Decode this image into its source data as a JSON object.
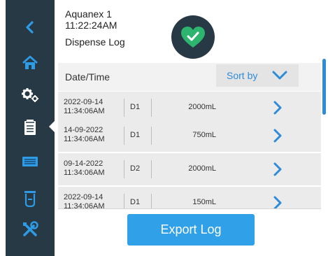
{
  "header": {
    "device_name": "Aquanex 1",
    "time": "11:22:24AM",
    "page_title": "Dispense Log",
    "status_icon": "heart-check-icon",
    "status_color": "#2db56f"
  },
  "table": {
    "column_title": "Date/Time",
    "sort_label": "Sort by",
    "rows": [
      {
        "date": "2022-09-14",
        "time": "11:34:06AM",
        "dispenser": "D1",
        "volume": "2000mL"
      },
      {
        "date": "14-09-2022",
        "time": "11:34:06AM",
        "dispenser": "D1",
        "volume": "750mL"
      },
      {
        "date": "09-14-2022",
        "time": "11:34:06AM",
        "dispenser": "D2",
        "volume": "2000mL"
      },
      {
        "date": "2022-09-14",
        "time": "11:34:06AM",
        "dispenser": "D1",
        "volume": "150mL"
      }
    ]
  },
  "export_label": "Export Log",
  "sidebar": {
    "items": [
      "back-icon",
      "home-icon",
      "settings-gears-icon",
      "log-clipboard-icon",
      "display-icon",
      "cup-icon",
      "tools-icon"
    ],
    "active": "log-clipboard-icon"
  },
  "colors": {
    "sidebar": "#263944",
    "accent": "#2e8bd8",
    "button": "#30a0e8"
  }
}
